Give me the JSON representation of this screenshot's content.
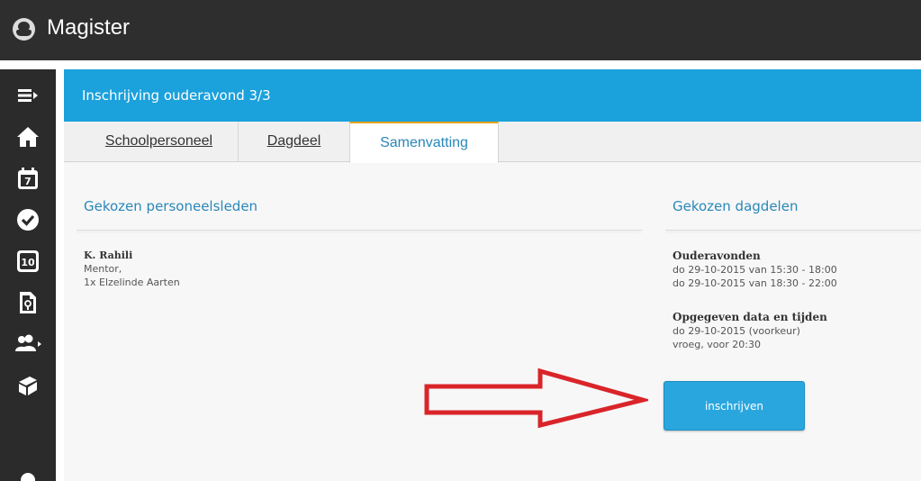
{
  "app": {
    "title": "Magister",
    "logo_icon": "magister-logo-icon"
  },
  "sidebar": {
    "items": [
      {
        "icon": "menu-expand-icon"
      },
      {
        "icon": "home-icon"
      },
      {
        "icon": "calendar-icon",
        "label": "7"
      },
      {
        "icon": "check-circle-icon"
      },
      {
        "icon": "grades-icon",
        "label": "10"
      },
      {
        "icon": "document-icon"
      },
      {
        "icon": "people-icon"
      },
      {
        "icon": "study-guide-icon"
      }
    ]
  },
  "header": {
    "title": "Inschrijving ouderavond 3/3",
    "color": "#1ba1dc"
  },
  "tabs": [
    {
      "label": "Schoolpersoneel",
      "active": false
    },
    {
      "label": "Dagdeel",
      "active": false
    },
    {
      "label": "Samenvatting",
      "active": true
    }
  ],
  "left_section": {
    "heading": "Gekozen personeelsleden",
    "person": {
      "name": "K. Rahili",
      "lines": [
        "Mentor,",
        "1x Elzelinde Aarten"
      ]
    }
  },
  "right_section": {
    "heading": "Gekozen dagdelen",
    "blocks": [
      {
        "title": "Ouderavonden",
        "lines": [
          "do 29-10-2015 van 15:30 - 18:00",
          "do 29-10-2015 van 18:30 - 22:00"
        ]
      },
      {
        "title": "Opgegeven data en tijden",
        "lines": [
          "do 29-10-2015 (voorkeur)",
          "vroeg, voor 20:30"
        ]
      }
    ]
  },
  "actions": {
    "submit_label": "inschrijven"
  },
  "annotation": {
    "icon": "red-arrow-icon",
    "color": "#d9252a"
  }
}
